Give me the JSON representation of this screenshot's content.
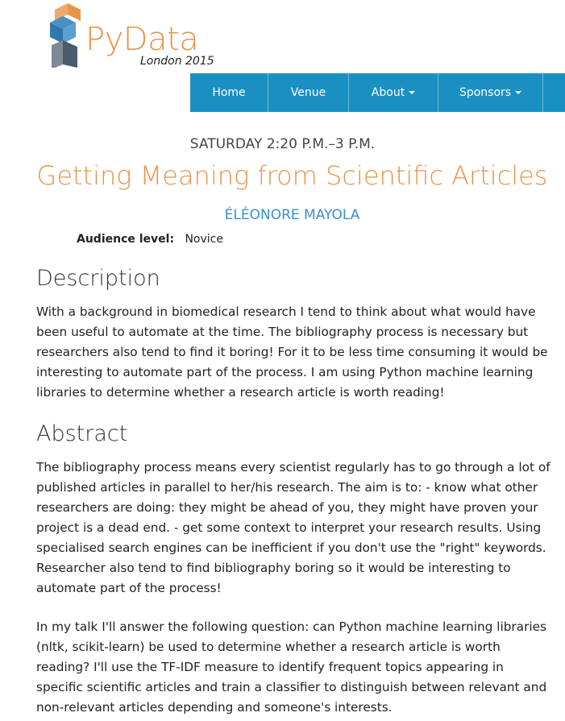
{
  "logo": {
    "wordmark": "PyData",
    "tagline": "London 2015"
  },
  "nav": {
    "items": [
      {
        "label": "Home",
        "dropdown": false
      },
      {
        "label": "Venue",
        "dropdown": false
      },
      {
        "label": "About",
        "dropdown": true
      },
      {
        "label": "Sponsors",
        "dropdown": true
      }
    ],
    "color": "#1a8fc2"
  },
  "talk": {
    "time": "SATURDAY 2:20 P.M.–3 P.M.",
    "title": "Getting Meaning from Scientific Articles",
    "speaker": "ÉLÉONORE MAYOLA",
    "audience_label": "Audience level:",
    "audience_value": "Novice"
  },
  "description": {
    "heading": "Description",
    "text": "With a background in biomedical research I tend to think about what would have been useful to automate at the time. The bibliography process is necessary but researchers also tend to find it boring! For it to be less time consuming it would be interesting to automate part of the process. I am using Python machine learning libraries to determine whether a research article is worth reading!"
  },
  "abstract": {
    "heading": "Abstract",
    "paragraphs": [
      "The bibliography process means every scientist regularly has to go through a lot of published articles in parallel to her/his research. The aim is to: - know what other researchers are doing: they might be ahead of you, they might have proven your project is a dead end. - get some context to interpret your research results. Using specialised search engines can be inefficient if you don't use the \"right\" keywords. Researcher also tend to find bibliography boring so it would be interesting to automate part of the process!",
      "In my talk I'll answer the following question: can Python machine learning libraries (nltk, scikit-learn) be used to determine whether a research article is worth reading? I'll use the TF-IDF measure to identify frequent topics appearing in specific scientific articles and train a classifier to distinguish between relevant and non-relevant articles depending and someone's interests."
    ]
  },
  "colors": {
    "accent": "#e8934a",
    "link": "#3a8fc8"
  }
}
